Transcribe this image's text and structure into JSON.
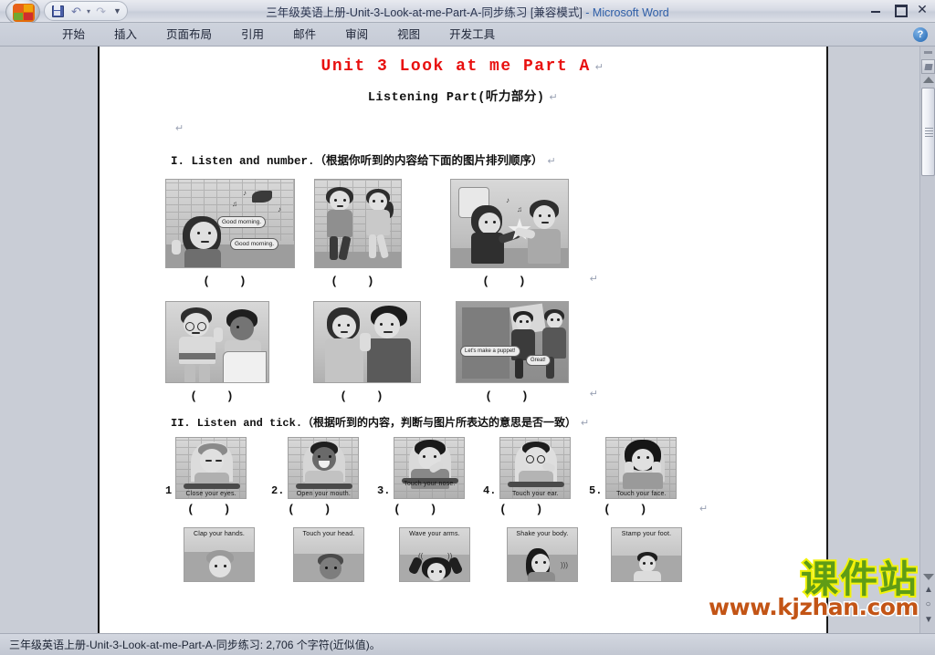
{
  "window": {
    "title_main": "三年级英语上册-Unit-3-Look-at-me-Part-A-同步练习 [兼容模式]",
    "title_tail": " - Microsoft Word",
    "minimize_label": "",
    "restore_label": "",
    "close_label": "✕"
  },
  "qat": {
    "save_label": "",
    "undo_label": "↶",
    "undo_dropdown_label": "▾",
    "redo_label": "↷",
    "customize_label": "▼"
  },
  "ribbon": {
    "tabs": [
      {
        "label": "开始"
      },
      {
        "label": "插入"
      },
      {
        "label": "页面布局"
      },
      {
        "label": "引用"
      },
      {
        "label": "邮件"
      },
      {
        "label": "审阅"
      },
      {
        "label": "视图"
      },
      {
        "label": "开发工具"
      }
    ],
    "help_label": "?"
  },
  "document": {
    "title": "Unit 3 Look at me Part A",
    "subtitle": "Listening Part(听力部分)",
    "pilcrow": "↵",
    "section1": {
      "heading": "I. Listen and number.（根据你听到的内容给下面的图片排列顺序）",
      "row1": [
        {
          "bubble1": "Good morning.",
          "bubble2": "Good morning.",
          "answer": "(     )"
        },
        {
          "bubble1": "",
          "bubble2": "",
          "answer": "(     )"
        },
        {
          "bubble1": "",
          "bubble2": "",
          "answer": "(     )"
        }
      ],
      "row2": [
        {
          "bubble1": "",
          "bubble2": "",
          "answer": "(     )"
        },
        {
          "bubble1": "",
          "bubble2": "",
          "answer": "(     )"
        },
        {
          "bubble1": "Let's make a puppet!",
          "bubble2": "Great!",
          "answer": "(     )"
        }
      ]
    },
    "section2": {
      "heading": "II. Listen and tick.（根据听到的内容，判断与图片所表达的意思是否一致）",
      "items": [
        {
          "number": "1",
          "caption": "Close your eyes.",
          "answer": "(     )"
        },
        {
          "number": "2.",
          "caption": "Open your mouth.",
          "answer": "(     )"
        },
        {
          "number": "3.",
          "caption": "Touch your nose.",
          "answer": "(     )"
        },
        {
          "number": "4.",
          "caption": "Touch your ear.",
          "answer": "(     )"
        },
        {
          "number": "5.",
          "caption": "Touch your face.",
          "answer": "(     )"
        }
      ],
      "items_row2": [
        {
          "caption": "Clap your hands."
        },
        {
          "caption": "Touch your head."
        },
        {
          "caption": "Wave your arms."
        },
        {
          "caption": "Shake your body."
        },
        {
          "caption": "Stamp your foot."
        }
      ]
    }
  },
  "watermark": {
    "cn": "课件站",
    "url": "www.kjzhan.com",
    "color_cn": "#5f9c16",
    "color_cn_stroke": "#f2f20a",
    "color_url": "#c35415"
  },
  "statusbar": {
    "text": "三年级英语上册-Unit-3-Look-at-me-Part-A-同步练习: 2,706 个字符(近似值)。"
  },
  "scrollbar": {
    "page_up_label": "▲",
    "select_object_label": "○",
    "page_down_label": "▼"
  }
}
